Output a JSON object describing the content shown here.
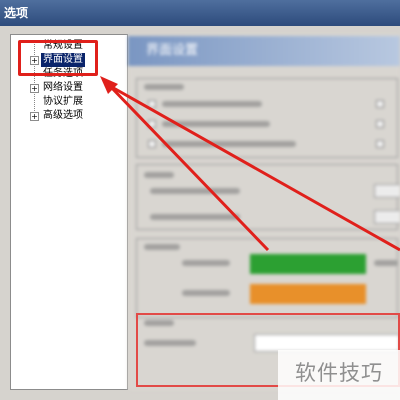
{
  "window": {
    "title": "选项"
  },
  "tree": {
    "items": [
      {
        "label": "常规设置",
        "expander": ""
      },
      {
        "label": "界面设置",
        "expander": "+",
        "selected": true
      },
      {
        "label": "任务选项",
        "expander": ""
      },
      {
        "label": "网络设置",
        "expander": "+"
      },
      {
        "label": "协议扩展",
        "expander": ""
      },
      {
        "label": "高级选项",
        "expander": "+"
      }
    ]
  },
  "panel": {
    "header": "界面设置"
  },
  "colors": {
    "download_swatch": "#2ca032",
    "upload_swatch": "#e8902a",
    "annotation_red": "#e0201b",
    "selection": "#0a246a"
  },
  "watermark": {
    "text": "软件技巧"
  }
}
